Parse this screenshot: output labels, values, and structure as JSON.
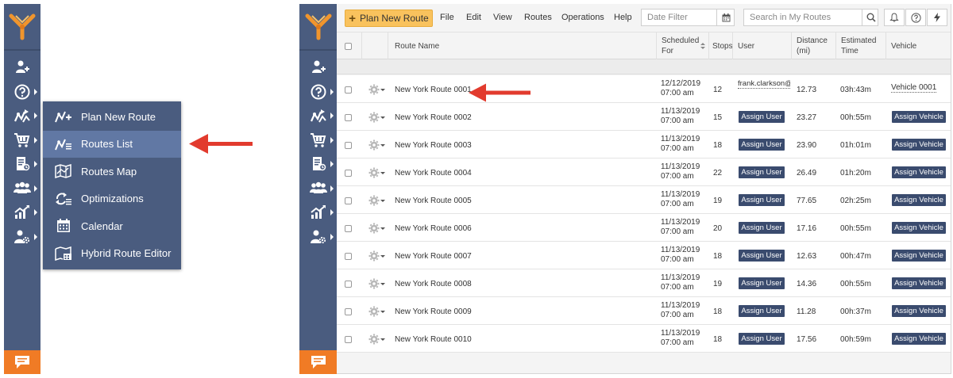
{
  "colors": {
    "sidebar_bg": "#4a5c7f",
    "sidebar_active": "#6178a4",
    "chat_button": "#f07b25",
    "plan_button": "#f9c25d",
    "assign_button": "#3a4b6e",
    "arrow": "#e23b2e",
    "logo_orange": "#f0952d"
  },
  "sidebar": {
    "items": [
      {
        "icon": "add-user-icon",
        "has_submenu": false
      },
      {
        "icon": "help-icon",
        "has_submenu": true
      },
      {
        "icon": "routes-icon",
        "has_submenu": true
      },
      {
        "icon": "cart-icon",
        "has_submenu": true
      },
      {
        "icon": "document-icon",
        "has_submenu": true
      },
      {
        "icon": "team-icon",
        "has_submenu": true
      },
      {
        "icon": "analytics-icon",
        "has_submenu": true
      },
      {
        "icon": "user-settings-icon",
        "has_submenu": true
      }
    ],
    "chat_icon": "chat-icon"
  },
  "dropdown": {
    "items": [
      {
        "label": "Plan New Route",
        "icon": "plan-route-icon"
      },
      {
        "label": "Routes List",
        "icon": "routes-list-icon",
        "active": true
      },
      {
        "label": "Routes Map",
        "icon": "routes-map-icon"
      },
      {
        "label": "Optimizations",
        "icon": "optimizations-icon"
      },
      {
        "label": "Calendar",
        "icon": "calendar-icon"
      },
      {
        "label": "Hybrid Route Editor",
        "icon": "hybrid-editor-icon"
      }
    ]
  },
  "toolbar": {
    "plan_button": "Plan New Route",
    "menus": [
      "File",
      "Edit",
      "View",
      "Routes",
      "Operations",
      "Help"
    ],
    "date_filter_placeholder": "Date Filter",
    "search_placeholder": "Search in My Routes"
  },
  "table": {
    "headers": {
      "route_name": "Route Name",
      "scheduled_1": "Scheduled",
      "scheduled_2": "For",
      "stops": "Stops",
      "user": "User",
      "distance_1": "Distance",
      "distance_2": "(mi)",
      "estimated_1": "Estimated",
      "estimated_2": "Time",
      "vehicle": "Vehicle"
    },
    "rows": [
      {
        "name": "New York Route 0001",
        "date": "12/12/2019",
        "time": "07:00 am",
        "stops": "12",
        "user": "frank.clarkson@",
        "distance": "12.73",
        "est": "03h:43m",
        "vehicle": "Vehicle 0001"
      },
      {
        "name": "New York Route 0002",
        "date": "11/13/2019",
        "time": "07:00 am",
        "stops": "15",
        "user": "Assign User",
        "distance": "23.27",
        "est": "00h:55m",
        "vehicle": "Assign Vehicle"
      },
      {
        "name": "New York Route 0003",
        "date": "11/13/2019",
        "time": "07:00 am",
        "stops": "18",
        "user": "Assign User",
        "distance": "23.90",
        "est": "01h:01m",
        "vehicle": "Assign Vehicle"
      },
      {
        "name": "New York Route 0004",
        "date": "11/13/2019",
        "time": "07:00 am",
        "stops": "22",
        "user": "Assign User",
        "distance": "26.49",
        "est": "01h:20m",
        "vehicle": "Assign Vehicle"
      },
      {
        "name": "New York Route 0005",
        "date": "11/13/2019",
        "time": "07:00 am",
        "stops": "19",
        "user": "Assign User",
        "distance": "77.65",
        "est": "02h:25m",
        "vehicle": "Assign Vehicle"
      },
      {
        "name": "New York Route 0006",
        "date": "11/13/2019",
        "time": "07:00 am",
        "stops": "20",
        "user": "Assign User",
        "distance": "17.16",
        "est": "00h:55m",
        "vehicle": "Assign Vehicle"
      },
      {
        "name": "New York Route 0007",
        "date": "11/13/2019",
        "time": "07:00 am",
        "stops": "18",
        "user": "Assign User",
        "distance": "12.63",
        "est": "00h:47m",
        "vehicle": "Assign Vehicle"
      },
      {
        "name": "New York Route 0008",
        "date": "11/13/2019",
        "time": "07:00 am",
        "stops": "19",
        "user": "Assign User",
        "distance": "14.36",
        "est": "00h:55m",
        "vehicle": "Assign Vehicle"
      },
      {
        "name": "New York Route 0009",
        "date": "11/13/2019",
        "time": "07:00 am",
        "stops": "18",
        "user": "Assign User",
        "distance": "11.28",
        "est": "00h:37m",
        "vehicle": "Assign Vehicle"
      },
      {
        "name": "New York Route 0010",
        "date": "11/13/2019",
        "time": "07:00 am",
        "stops": "18",
        "user": "Assign User",
        "distance": "17.56",
        "est": "00h:59m",
        "vehicle": "Assign Vehicle"
      }
    ]
  }
}
